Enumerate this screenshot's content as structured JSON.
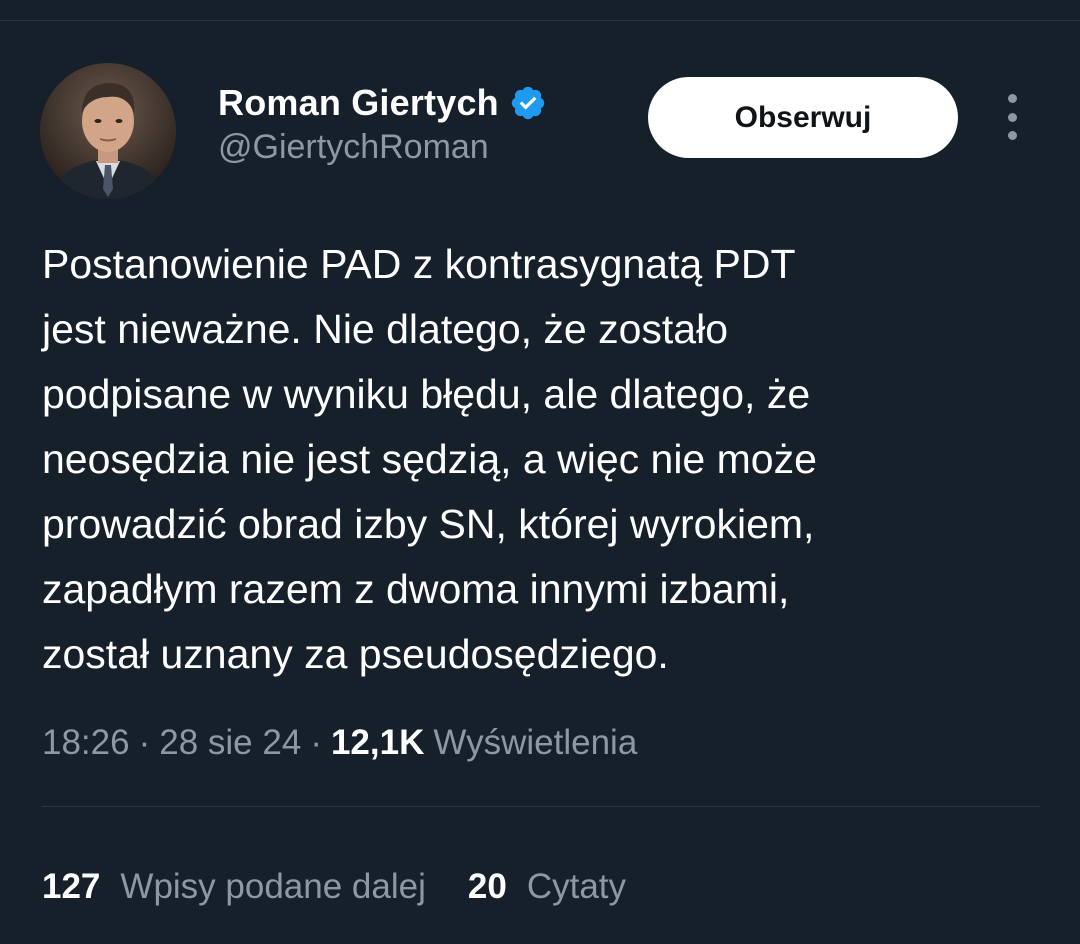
{
  "author": {
    "display_name": "Roman Giertych",
    "handle": "@GiertychRoman",
    "verified_icon": "verified-badge-icon",
    "avatar_icon": "profile-photo"
  },
  "actions": {
    "follow_label": "Obserwuj",
    "more_icon": "more-vertical-icon"
  },
  "tweet": {
    "lines": [
      "Postanowienie PAD z kontrasygnatą PDT",
      "jest nieważne. Nie dlatego, że zostało",
      "podpisane w wyniku błędu, ale dlatego, że",
      "neosędzia nie jest sędzią, a więc nie może",
      "prowadzić obrad izby SN, której wyrokiem,",
      "zapadłym razem z dwoma innymi izbami,",
      "został uznany za pseudosędziego."
    ]
  },
  "meta": {
    "time": "18:26",
    "separator": "·",
    "date": "28 sie 24",
    "views_count": "12,1K",
    "views_label": "Wyświetlenia"
  },
  "stats": {
    "reposts_count": "127",
    "reposts_label": "Wpisy podane dalej",
    "quotes_count": "20",
    "quotes_label": "Cytaty"
  },
  "colors": {
    "background": "#16202a",
    "text_primary": "#ffffff",
    "text_secondary": "#8b98a5",
    "verified_blue": "#1d9bf0",
    "divider": "#2b3640"
  }
}
